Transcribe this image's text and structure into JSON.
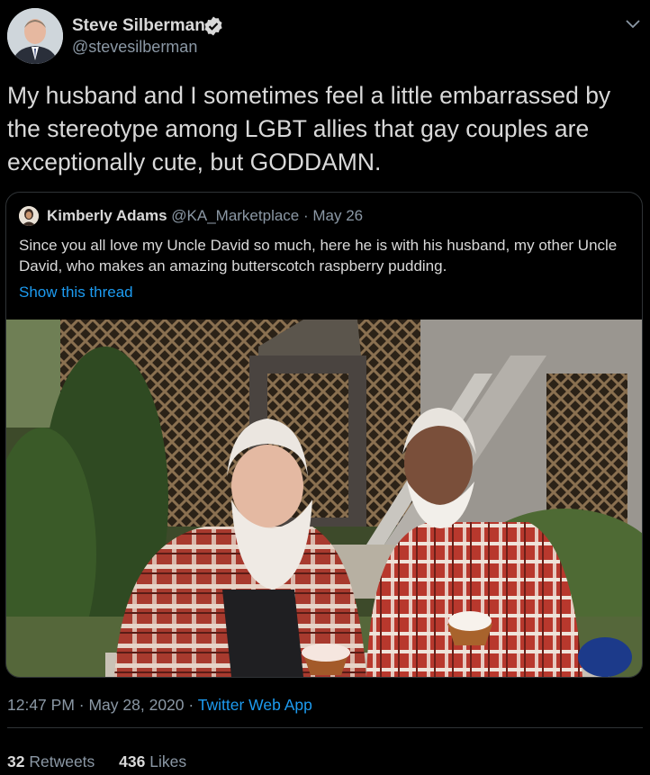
{
  "author": {
    "name": "Steve Silberman",
    "handle": "@stevesilberman",
    "verified": true,
    "avatar_icon": "profile-photo"
  },
  "tweet": {
    "text": "My husband and I sometimes feel a little embarrassed by the stereotype among LGBT allies that gay couples are exceptionally cute, but GODDAMN."
  },
  "quoted": {
    "name": "Kimberly Adams",
    "handle": "@KA_Marketplace",
    "separator": " · ",
    "date": "May 26",
    "text": "Since you all love my Uncle David so much, here he is with his husband, my other Uncle David, who makes an amazing butterscotch raspberry pudding.",
    "show_thread": "Show this thread",
    "photo_icon": "photo-two-men-with-pudding"
  },
  "meta": {
    "time": "12:47 PM",
    "separator": " · ",
    "date": "May 28, 2020",
    "app": "Twitter Web App"
  },
  "stats": {
    "retweets_count": "32",
    "retweets_label": "Retweets",
    "likes_count": "436",
    "likes_label": "Likes"
  },
  "colors": {
    "background": "#000000",
    "text": "#d9d9d9",
    "secondary": "#8b98a5",
    "link": "#1d9bf0",
    "border": "#2f3336"
  }
}
